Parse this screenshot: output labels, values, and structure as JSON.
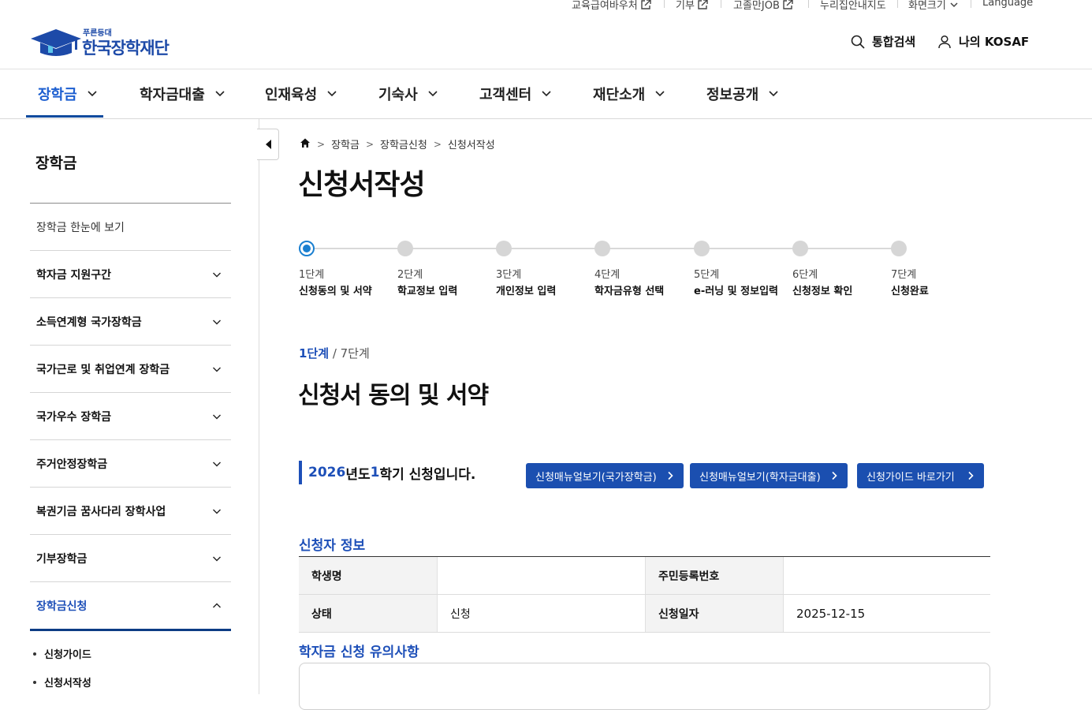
{
  "utility": {
    "voucher": "교육급여바우처",
    "donation": "기부",
    "job": "고졸만JOB",
    "map": "누리집안내지도",
    "screen_size": "화면크기",
    "language": "Language"
  },
  "header": {
    "logo_sub": "푸른등대",
    "logo_name": "한국장학재단",
    "search": "통합검색",
    "my_kosaf": "나의 KOSAF"
  },
  "gnb": [
    "장학금",
    "학자금대출",
    "인재육성",
    "기숙사",
    "고객센터",
    "재단소개",
    "정보공개"
  ],
  "sidebar": {
    "title": "장학금",
    "items": [
      "장학금 한눈에 보기",
      "학자금 지원구간",
      "소득연계형 국가장학금",
      "국가근로 및 취업연계 장학금",
      "국가우수 장학금",
      "주거안정장학금",
      "복권기금 꿈사다리 장학사업",
      "기부장학금",
      "장학금신청"
    ],
    "sub_items": [
      "신청가이드",
      "신청서작성"
    ]
  },
  "breadcrumb": [
    "장학금",
    "장학금신청",
    "신청서작성"
  ],
  "page_title": "신청서작성",
  "steps": [
    {
      "num": "1단계",
      "title": "신청동의 및 서약"
    },
    {
      "num": "2단계",
      "title": "학교정보 입력"
    },
    {
      "num": "3단계",
      "title": "개인정보 입력"
    },
    {
      "num": "4단계",
      "title": "학자금유형 선택"
    },
    {
      "num": "5단계",
      "title": "e-러닝 및 정보입력"
    },
    {
      "num": "6단계",
      "title": "신청정보 확인"
    },
    {
      "num": "7단계",
      "title": "신청완료"
    }
  ],
  "step_count": {
    "current": "1단계",
    "total": " / 7단계"
  },
  "section_title": "신청서 동의 및 서약",
  "notice": {
    "year": "2026",
    "year_suffix": "년도 ",
    "term": "1",
    "term_suffix": "학기 신청입니다."
  },
  "buttons": [
    "신청매뉴얼보기(국가장학금)",
    "신청매뉴얼보기(학자금대출)",
    "신청가이드 바로가기"
  ],
  "applicant": {
    "title": "신청자 정보",
    "student_name_label": "학생명",
    "student_name_value": "",
    "rrn_label": "주민등록번호",
    "rrn_value": "",
    "status_label": "상태",
    "status_value": "신청",
    "date_label": "신청일자",
    "date_value": "2025-12-15"
  },
  "notes_title": "학자금 신청 유의사항",
  "colors": {
    "accent": "#1d4fb8",
    "button": "#1b4fb0",
    "nav_underline": "#0d4a9e",
    "step_active": "#1a7fd0"
  }
}
